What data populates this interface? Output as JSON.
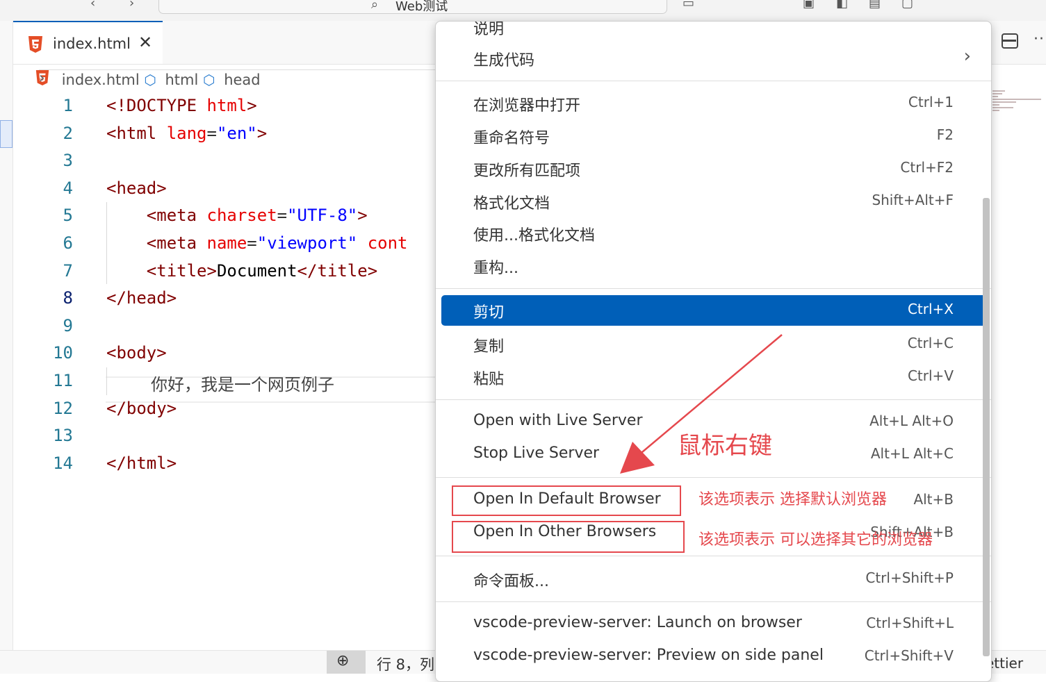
{
  "titlebar": {
    "search_text": "Web测试"
  },
  "tab": {
    "filename": "index.html",
    "close": "✕"
  },
  "breadcrumb": {
    "file": "index.html",
    "node1": "html",
    "node2": "head"
  },
  "editor": {
    "lines": [
      {
        "n": "1"
      },
      {
        "n": "2"
      },
      {
        "n": "3"
      },
      {
        "n": "4"
      },
      {
        "n": "5"
      },
      {
        "n": "6"
      },
      {
        "n": "7"
      },
      {
        "n": "8"
      },
      {
        "n": "9"
      },
      {
        "n": "10"
      },
      {
        "n": "11"
      },
      {
        "n": "12"
      },
      {
        "n": "13"
      },
      {
        "n": "14"
      }
    ],
    "code": {
      "l1_open": "<!DOCTYPE ",
      "l1_kw": "html",
      "l1_close": ">",
      "l2_open": "<html ",
      "l2_attr": "lang",
      "l2_eq": "=",
      "l2_val": "\"en\"",
      "l2_close": ">",
      "l4": "<head>",
      "l5_open": "    <meta ",
      "l5_attr": "charset",
      "l5_eq": "=",
      "l5_val": "\"UTF-8\"",
      "l5_close": ">",
      "l6_open": "    <meta ",
      "l6_attr": "name",
      "l6_eq": "=",
      "l6_val": "\"viewport\"",
      "l6_rest": " cont",
      "l7_open": "    <title>",
      "l7_text": "Document",
      "l7_close": "</title>",
      "l8": "</head>",
      "l10": "<body>",
      "l11": "你好，我是一个网页例子",
      "l12": "</body>",
      "l14": "</html>"
    }
  },
  "statusbar": {
    "position": "行 8，列",
    "prettier": "ettier"
  },
  "context_menu": {
    "items": [
      {
        "label": "说明",
        "key": ""
      },
      {
        "label": "生成代码",
        "key": "",
        "submenu": "›"
      },
      {
        "label": "在浏览器中打开",
        "key": "Ctrl+1"
      },
      {
        "label": "重命名符号",
        "key": "F2"
      },
      {
        "label": "更改所有匹配项",
        "key": "Ctrl+F2"
      },
      {
        "label": "格式化文档",
        "key": "Shift+Alt+F"
      },
      {
        "label": "使用...格式化文档",
        "key": ""
      },
      {
        "label": "重构...",
        "key": ""
      },
      {
        "label": "剪切",
        "key": "Ctrl+X"
      },
      {
        "label": "复制",
        "key": "Ctrl+C"
      },
      {
        "label": "粘贴",
        "key": "Ctrl+V"
      },
      {
        "label": "Open with Live Server",
        "key": "Alt+L Alt+O"
      },
      {
        "label": "Stop Live Server",
        "key": "Alt+L Alt+C"
      },
      {
        "label": "Open In Default Browser",
        "key": "Alt+B"
      },
      {
        "label": "Open In Other Browsers",
        "key": "Shift+Alt+B"
      },
      {
        "label": "命令面板...",
        "key": "Ctrl+Shift+P"
      },
      {
        "label": "vscode-preview-server: Launch on browser",
        "key": "Ctrl+Shift+L"
      },
      {
        "label": "vscode-preview-server: Preview on side panel",
        "key": "Ctrl+Shift+V"
      }
    ]
  },
  "annotations": {
    "right_click": "鼠标右键",
    "default_browser_note": "该选项表示 选择默认浏览器",
    "other_browsers_note": "该选项表示 可以选择其它的浏览器"
  },
  "colors": {
    "accent": "#005fb8",
    "annotation_red": "#e5484d",
    "tag": "#800000",
    "attribute": "#e50000",
    "string": "#0000ff",
    "line_number": "#237893"
  }
}
